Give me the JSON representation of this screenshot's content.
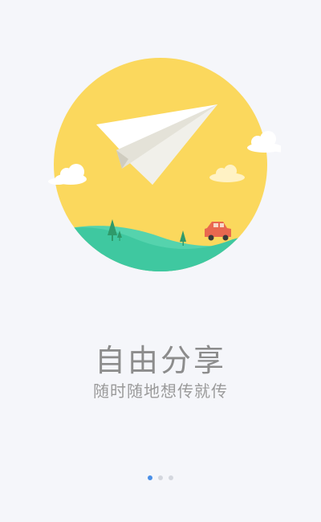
{
  "onboarding": {
    "title": "自由分享",
    "subtitle": "随时随地想传就传",
    "pager": {
      "total": 3,
      "active_index": 0
    }
  },
  "colors": {
    "sun_circle": "#fbd85d",
    "hill_front": "#3fc8a0",
    "hill_back": "#55d3ad",
    "plane": "#ffffff",
    "car": "#e9684f",
    "active_dot": "#4a8fe7",
    "inactive_dot": "#d4d7de",
    "text": "#8c8c8c"
  },
  "illustration": {
    "name": "paper-plane-over-hills"
  }
}
